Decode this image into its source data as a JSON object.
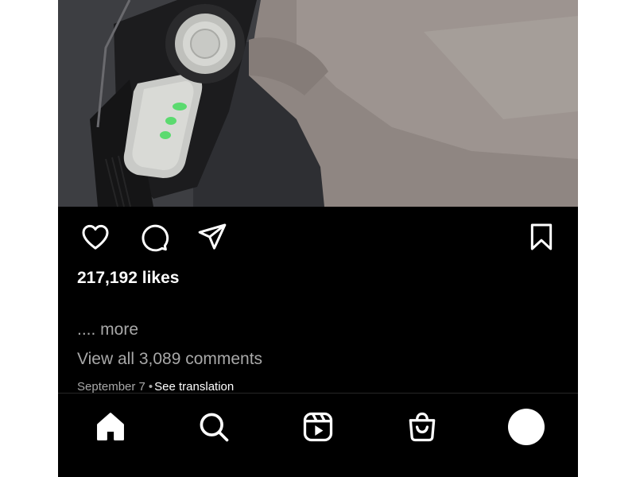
{
  "post": {
    "likes_text": "217,192 likes",
    "more_text": ".... more",
    "view_comments_text": "View all 3,089 comments",
    "date_text": "September 7",
    "separator": "•",
    "translation_text": "See translation"
  },
  "actions": {
    "icons": [
      "heart-icon",
      "comment-icon",
      "send-icon",
      "bookmark-icon"
    ]
  },
  "bottom_nav": {
    "icons": [
      "home-icon",
      "search-icon",
      "reels-icon",
      "shop-icon",
      "profile-avatar"
    ]
  },
  "colors": {
    "background": "#000000",
    "primary_text": "#ffffff",
    "secondary_text": "#a8a8a8"
  }
}
